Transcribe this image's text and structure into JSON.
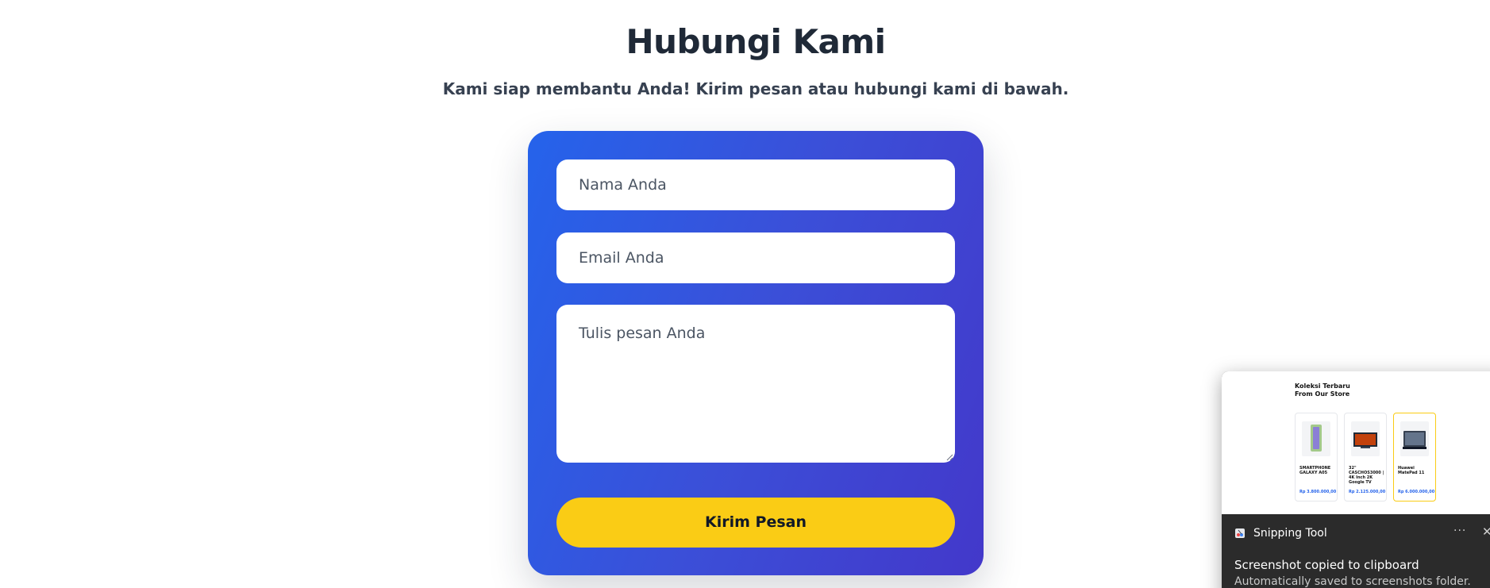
{
  "header": {
    "title": "Hubungi Kami",
    "subtitle": "Kami siap membantu Anda! Kirim pesan atau hubungi kami di bawah."
  },
  "form": {
    "name_placeholder": "Nama Anda",
    "email_placeholder": "Email Anda",
    "message_placeholder": "Tulis pesan Anda",
    "submit_label": "Kirim Pesan"
  },
  "colors": {
    "card_gradient_start": "#2563eb",
    "card_gradient_end": "#4338ca",
    "button": "#facc15",
    "heading": "#1f2937"
  },
  "toast": {
    "app_name": "Snipping Tool",
    "more_icon": "more-icon",
    "close_icon": "close-icon",
    "title": "Screenshot copied to clipboard",
    "body": "Automatically saved to screenshots folder.",
    "preview": {
      "heading": "Koleksi Terbaru From Our Store",
      "products": [
        {
          "name": "SMARTPHONE GALAXY A05",
          "price": "Rp 3.800.000,00"
        },
        {
          "name": "32\" CASCHOS3000 | 4K Inch 2K Google TV",
          "price": "Rp 2.125.000,00"
        },
        {
          "name": "Huawei MatePad 11",
          "price": "Rp 6.000.000,00"
        }
      ]
    }
  }
}
